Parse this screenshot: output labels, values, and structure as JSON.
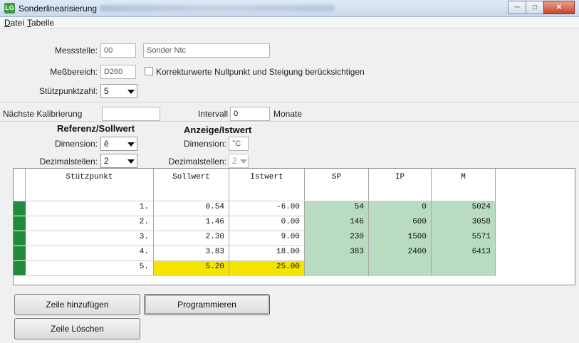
{
  "window": {
    "title": "Sonderlinearisierung",
    "app_icon": "LG",
    "buttons": [
      "minimize",
      "maximize",
      "close"
    ]
  },
  "menu": [
    {
      "label": "Datei"
    },
    {
      "label": "Tabelle"
    }
  ],
  "form": {
    "messstelle_label": "Messstelle:",
    "messstelle_value": "00",
    "messstelle_name": "Sonder Ntc",
    "messbereich_label": "Meßbereich:",
    "messbereich_value": "D260",
    "korrektur_label": "Korrekturwerte Nullpunkt und Steigung berücksichtigen",
    "stuetzpunktzahl_label": "Stützpunktzahl:",
    "stuetzpunktzahl_value": "5",
    "kalibrierung_label": "Nächste Kalibrierung",
    "kalibrierung_value": "",
    "intervall_label": "Intervall",
    "intervall_value": "0",
    "intervall_unit": "Monate"
  },
  "referenz": {
    "heading": "Referenz/Sollwert",
    "dimension_label": "Dimension:",
    "dimension_value": "ê",
    "dezimal_label": "Dezimalstellen:",
    "dezimal_value": "2"
  },
  "anzeige": {
    "heading": "Anzeige/Istwert",
    "dimension_label": "Dimension:",
    "dimension_value": "°C",
    "dezimal_label": "Dezimalstellen:",
    "dezimal_value": "2"
  },
  "table": {
    "columns": [
      "Stützpunkt",
      "Sollwert",
      "Istwert",
      "SP",
      "IP",
      "M"
    ],
    "rows": [
      [
        "1.",
        "0.54",
        "-6.00",
        "54",
        "0",
        "5024"
      ],
      [
        "2.",
        "1.46",
        "0.00",
        "146",
        "600",
        "3058"
      ],
      [
        "3.",
        "2.30",
        "9.00",
        "230",
        "1500",
        "5571"
      ],
      [
        "4.",
        "3.83",
        "18.00",
        "383",
        "2400",
        "6413"
      ],
      [
        "5.",
        "5.20",
        "25.00",
        "",
        "",
        ""
      ]
    ],
    "highlight_row": 4
  },
  "buttons": {
    "add_row": "Zeile hinzufügen",
    "program": "Programmieren",
    "delete_row": "Zeile Löschen"
  },
  "colors": {
    "marker": "#1e8c3a",
    "computed_bg": "#b8dcc1",
    "highlight": "#f5e400"
  }
}
